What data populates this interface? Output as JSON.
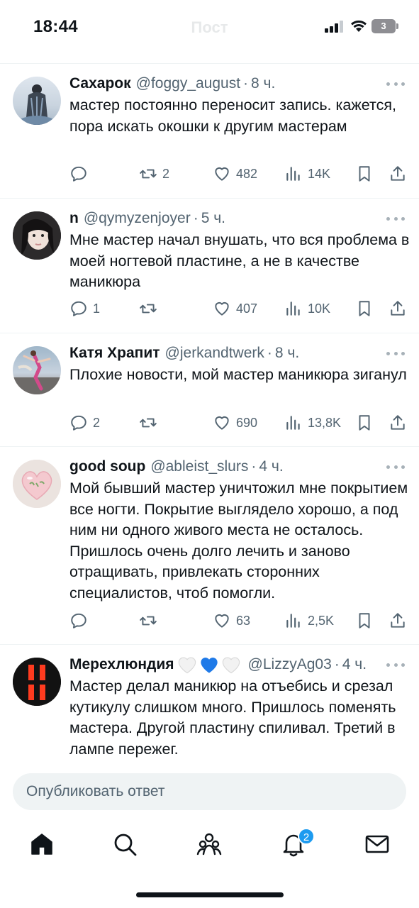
{
  "status_bar": {
    "time": "18:44",
    "battery": "3",
    "header_title": "Пост"
  },
  "tweets": [
    {
      "author": "Сахарок",
      "handle": "@foggy_august",
      "time": "8 ч.",
      "text": "мастер постоянно переносит запись. кажется, пора искать окошки к другим мастерам",
      "replies": "",
      "retweets": "2",
      "likes": "482",
      "views": "14K"
    },
    {
      "author": "n",
      "handle": "@qymyzenjoyer",
      "time": "5 ч.",
      "text": "Мне мастер начал внушать, что вся проблема в моей ногтевой пластине, а не в качестве маникюра",
      "replies": "1",
      "retweets": "",
      "likes": "407",
      "views": "10K"
    },
    {
      "author": "Катя Храпит",
      "handle": "@jerkandtwerk",
      "time": "8 ч.",
      "text": "Плохие новости, мой мастер маникюра зиганул",
      "replies": "2",
      "retweets": "",
      "likes": "690",
      "views": "13,8K"
    },
    {
      "author": "good soup",
      "handle": "@ableist_slurs",
      "time": "4 ч.",
      "text": "Мой бывший мастер уничтожил мне покрытием все ногти. Покрытие выглядело хорошо, а под ним ни одного живого места не осталось. Пришлось очень долго лечить и заново отращивать, привлекать сторонних специалистов, чтоб помогли.",
      "replies": "",
      "retweets": "",
      "likes": "63",
      "views": "2,5K"
    },
    {
      "author": "Мерехлюндия",
      "handle": "@LizzyAg03",
      "time": "4 ч.",
      "text": "Мастер делал маникюр на отъебись и срезал кутикулу слишком много. Пришлось поменять мастера. Другой пластину спиливал. Третий в лампе пережег.",
      "author_emoji": [
        "white-heart",
        "blue-heart",
        "white-heart"
      ]
    }
  ],
  "reply_box": {
    "placeholder": "Опубликовать ответ"
  },
  "nav": {
    "notifications_badge": "2"
  },
  "colors": {
    "text": "#0f1419",
    "secondary": "#536471",
    "accent": "#1d9bf0",
    "divider": "#eff3f4"
  }
}
